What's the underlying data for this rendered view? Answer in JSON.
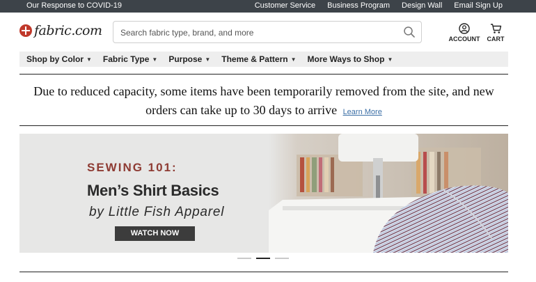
{
  "topbar": {
    "covid_link": "Our Response to COVID-19",
    "links": [
      "Customer Service",
      "Business Program",
      "Design Wall",
      "Email Sign Up"
    ]
  },
  "header": {
    "logo_text": "fabric.com",
    "search_placeholder": "Search fabric type, brand, and more",
    "account_label": "ACCOUNT",
    "cart_label": "CART"
  },
  "nav": {
    "items": [
      "Shop by Color",
      "Fabric Type",
      "Purpose",
      "Theme & Pattern",
      "More Ways to Shop"
    ]
  },
  "notice": {
    "text": "Due to reduced capacity, some items have been temporarily removed from the site, and new orders can take up to 30 days to arrive",
    "link": "Learn More"
  },
  "banner": {
    "eyebrow": "SEWING 101:",
    "headline": "Men’s Shirt Basics",
    "byline": "by Little Fish Apparel",
    "cta": "WATCH NOW"
  },
  "carousel": {
    "slide_count": 3,
    "active_index": 1
  },
  "colors": {
    "topbar": "#3d4349",
    "brand_red": "#c0392b",
    "eyebrow": "#8e3b33",
    "link": "#3a6ea5"
  }
}
